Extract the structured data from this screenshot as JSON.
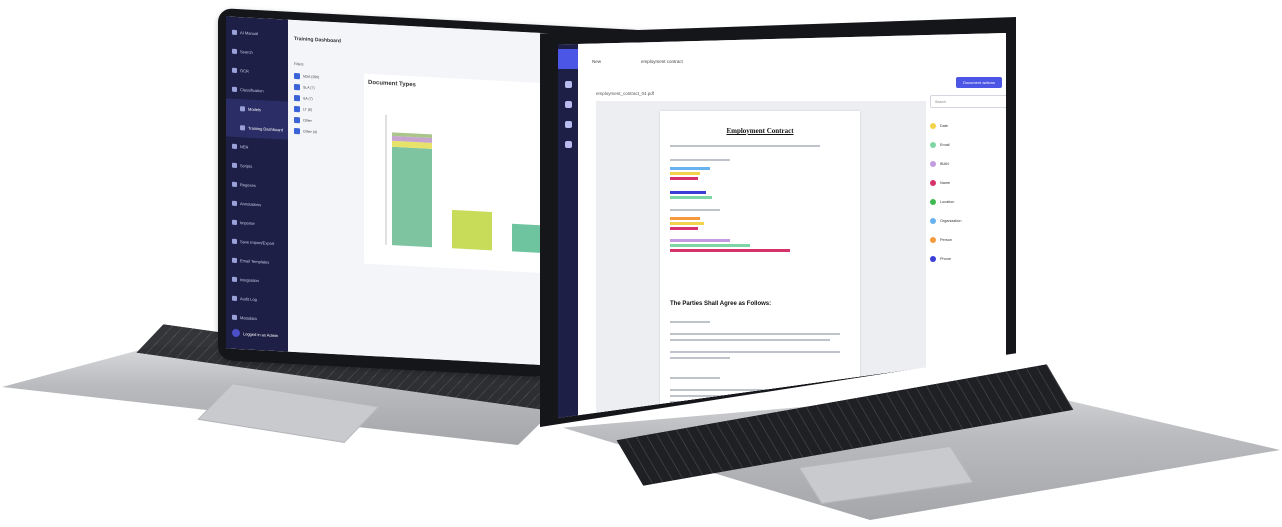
{
  "left_app": {
    "title": "Training Dashboard",
    "sidebar": [
      {
        "label": "AI Manual"
      },
      {
        "label": "Search"
      },
      {
        "label": "OCR"
      },
      {
        "label": "Classification"
      },
      {
        "label": "Models",
        "sub": true
      },
      {
        "label": "Training Dashboard",
        "sub": true
      },
      {
        "label": "NER"
      },
      {
        "label": "Scripts"
      },
      {
        "label": "Regexes"
      },
      {
        "label": "Annotations"
      },
      {
        "label": "Importer"
      },
      {
        "label": "Save Import/Export"
      },
      {
        "label": "Email Templates"
      },
      {
        "label": "Integration"
      },
      {
        "label": "Audit Log"
      },
      {
        "label": "Metadata"
      }
    ],
    "user_label": "Logged in as Admin",
    "filters_label": "Filters",
    "filter_items": [
      "NDA (290)",
      "SLA (7)",
      "SA (7)",
      "LT (8)",
      "Other",
      "Other (4)"
    ],
    "chart_title": "Document Types",
    "colors": {
      "sidebar": "#1d1f47",
      "accent": "#3a63d8"
    }
  },
  "chart_data": {
    "type": "bar",
    "title": "Document Types",
    "categories": [
      "",
      "",
      ""
    ],
    "series_colors": [
      "#7fc4a1",
      "#c9dc5a",
      "#6fc4a0"
    ],
    "values": [
      0.82,
      0.32,
      0.23
    ],
    "stack_top": [
      {
        "value": 0.05,
        "color": "#e7e36a"
      },
      {
        "value": 0.04,
        "color": "#c7a3cf"
      },
      {
        "value": 0.03,
        "color": "#a9c58a"
      }
    ]
  },
  "right_app": {
    "tabs": [
      "New",
      "employment contract"
    ],
    "breadcrumb": "employment_contract_04.pdf",
    "action_button": "Document actions",
    "close_glyph": "X",
    "document": {
      "title": "Employment Contract",
      "heading": "The Parties Shall Agree as Follows:"
    },
    "entities": [
      {
        "label": "Date",
        "color": "#f2d34b"
      },
      {
        "label": "Email",
        "color": "#7ed6a4"
      },
      {
        "label": "IBAN",
        "color": "#c49be0"
      },
      {
        "label": "Name",
        "color": "#d6336c"
      },
      {
        "label": "Location",
        "color": "#3fb950"
      },
      {
        "label": "Organization",
        "color": "#69b2f0"
      },
      {
        "label": "Person",
        "color": "#f79a3e"
      },
      {
        "label": "Phone",
        "color": "#3b3fd8"
      }
    ],
    "search_placeholder": "Search"
  }
}
